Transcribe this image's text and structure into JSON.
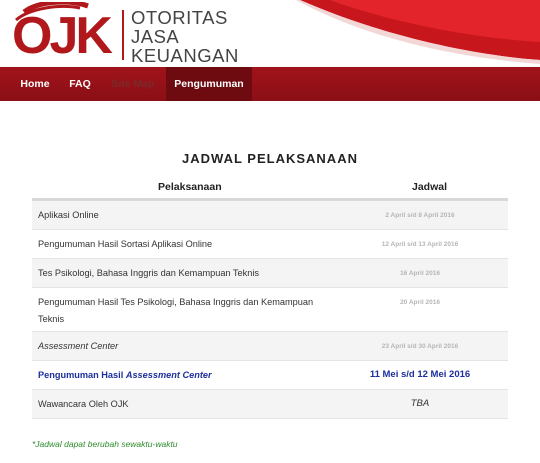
{
  "brand": {
    "logo_text": "OJK",
    "name_lines": [
      "OTORITAS",
      "JASA",
      "KEUANGAN"
    ]
  },
  "nav": {
    "items": [
      {
        "label": "Home"
      },
      {
        "label": "FAQ"
      },
      {
        "label": "Site Map"
      },
      {
        "label": "Pengumuman"
      }
    ]
  },
  "main": {
    "title": "JADWAL PELAKSANAAN",
    "table": {
      "headers": {
        "pelaksanaan": "Pelaksanaan",
        "jadwal": "Jadwal"
      },
      "rows": [
        {
          "pelaksanaan": "Aplikasi Online",
          "jadwal": "2 April s/d 8 April 2016"
        },
        {
          "pelaksanaan": "Pengumuman Hasil Sortasi Aplikasi Online",
          "jadwal": "12 April s/d 13 April 2016"
        },
        {
          "pelaksanaan": "Tes Psikologi, Bahasa Inggris dan Kemampuan Teknis",
          "jadwal": "16 April 2016"
        },
        {
          "pelaksanaan_line1": "Pengumuman Hasil Tes Psikologi, Bahasa Inggris dan Kemampuan",
          "pelaksanaan_line2": "Teknis",
          "jadwal": "20 April 2016"
        },
        {
          "pelaksanaan": "Assessment Center",
          "jadwal": "23 April s/d 30 April 2016"
        },
        {
          "pelaksanaan_prefix": "Pengumuman Hasil ",
          "pelaksanaan_emph": "Assessment Center",
          "jadwal": "11 Mei s/d 12 Mei 2016"
        },
        {
          "pelaksanaan": "Wawancara Oleh OJK",
          "jadwal": "TBA"
        }
      ]
    },
    "footnote": "*Jadwal dapat berubah sewaktu-waktu"
  },
  "colors": {
    "brand_red": "#b0181b",
    "nav_bg": "#8a0f16",
    "highlight_blue": "#1c2f9c",
    "footnote_green": "#2e8b2e"
  }
}
